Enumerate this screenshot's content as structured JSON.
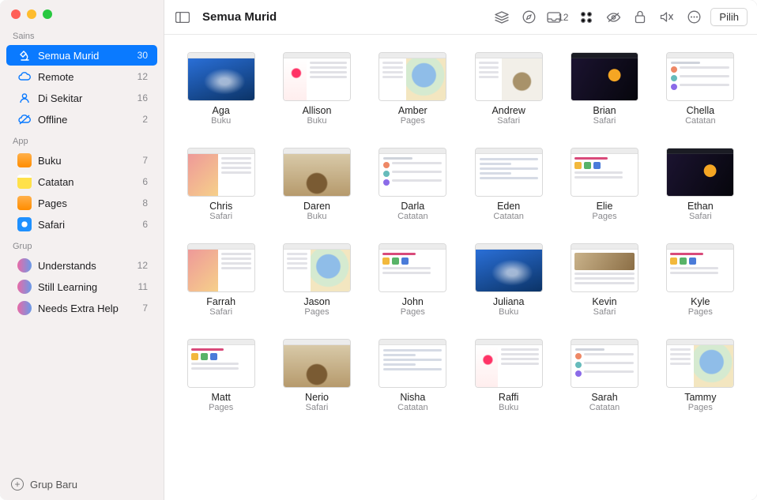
{
  "header": {
    "title": "Semua Murid",
    "inbox_count": "12",
    "select_label": "Pilih"
  },
  "sidebar": {
    "sections": [
      {
        "label": "Sains",
        "items": [
          {
            "icon": "microscope",
            "color": "#0a7aff",
            "label": "Semua Murid",
            "count": "30",
            "selected": true
          },
          {
            "icon": "cloud-remote",
            "color": "#0a7aff",
            "label": "Remote",
            "count": "12"
          },
          {
            "icon": "person",
            "color": "#0a7aff",
            "label": "Di Sekitar",
            "count": "16"
          },
          {
            "icon": "cloud-off",
            "color": "#0a7aff",
            "label": "Offline",
            "count": "2"
          }
        ]
      },
      {
        "label": "App",
        "items": [
          {
            "icon": "app",
            "bg": "#ff9500",
            "label": "Buku",
            "count": "7"
          },
          {
            "icon": "app",
            "bg": "#ffcc00",
            "label": "Catatan",
            "count": "6"
          },
          {
            "icon": "app",
            "bg": "#ff9500",
            "label": "Pages",
            "count": "8"
          },
          {
            "icon": "app",
            "bg": "#1e90ff",
            "label": "Safari",
            "count": "6"
          }
        ]
      },
      {
        "label": "Grup",
        "items": [
          {
            "icon": "group",
            "bg": "#e86aa6",
            "label": "Understands",
            "count": "12"
          },
          {
            "icon": "group",
            "bg": "#b86ae8",
            "label": "Still Learning",
            "count": "11"
          },
          {
            "icon": "group",
            "bg": "#e86aa6",
            "label": "Needs Extra Help",
            "count": "7"
          }
        ]
      }
    ],
    "footer": {
      "label": "Grup Baru"
    }
  },
  "students": [
    {
      "name": "Aga",
      "app": "Buku",
      "variant": "tv-photo-blue"
    },
    {
      "name": "Allison",
      "app": "Buku",
      "variant": "tv-bird"
    },
    {
      "name": "Amber",
      "app": "Pages",
      "variant": "tv-map"
    },
    {
      "name": "Andrew",
      "app": "Safari",
      "variant": "tv-animal"
    },
    {
      "name": "Brian",
      "app": "Safari",
      "variant": "tv-dark"
    },
    {
      "name": "Chella",
      "app": "Catatan",
      "variant": "tv-page"
    },
    {
      "name": "Chris",
      "app": "Safari",
      "variant": "tv-split"
    },
    {
      "name": "Daren",
      "app": "Buku",
      "variant": "tv-mammoth"
    },
    {
      "name": "Darla",
      "app": "Catatan",
      "variant": "tv-page"
    },
    {
      "name": "Eden",
      "app": "Catatan",
      "variant": "tv-doc-lines"
    },
    {
      "name": "Elie",
      "app": "Pages",
      "variant": "tv-pink"
    },
    {
      "name": "Ethan",
      "app": "Safari",
      "variant": "tv-dark"
    },
    {
      "name": "Farrah",
      "app": "Safari",
      "variant": "tv-split"
    },
    {
      "name": "Jason",
      "app": "Pages",
      "variant": "tv-map"
    },
    {
      "name": "John",
      "app": "Pages",
      "variant": "tv-pink"
    },
    {
      "name": "Juliana",
      "app": "Buku",
      "variant": "tv-photo-blue"
    },
    {
      "name": "Kevin",
      "app": "Safari",
      "variant": "tv-safari-doc"
    },
    {
      "name": "Kyle",
      "app": "Pages",
      "variant": "tv-pink"
    },
    {
      "name": "Matt",
      "app": "Pages",
      "variant": "tv-pink"
    },
    {
      "name": "Nerio",
      "app": "Safari",
      "variant": "tv-mammoth"
    },
    {
      "name": "Nisha",
      "app": "Catatan",
      "variant": "tv-doc-lines"
    },
    {
      "name": "Raffi",
      "app": "Buku",
      "variant": "tv-bird"
    },
    {
      "name": "Sarah",
      "app": "Catatan",
      "variant": "tv-page"
    },
    {
      "name": "Tammy",
      "app": "Pages",
      "variant": "tv-map"
    }
  ]
}
